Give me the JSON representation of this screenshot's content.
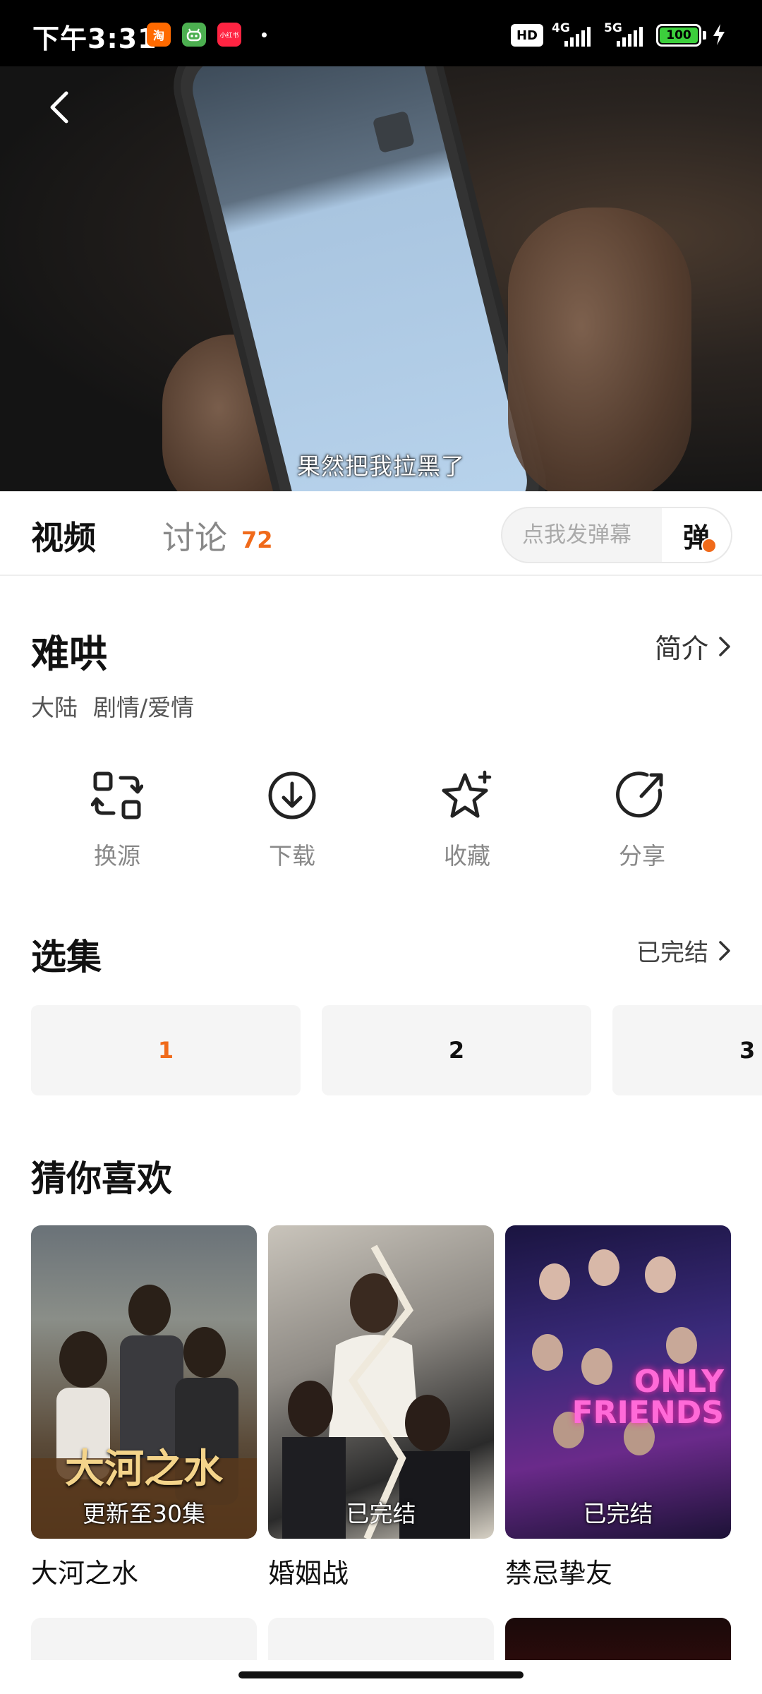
{
  "status_bar": {
    "time": "下午3:31",
    "apps": [
      {
        "name": "taobao-app-icon",
        "label": "淘",
        "color": "#ff6a00"
      },
      {
        "name": "android-app-icon",
        "label": "",
        "color": "#4caf50"
      },
      {
        "name": "xiaohongshu-app-icon",
        "label": "小红书",
        "color": "#ff2442"
      }
    ],
    "hd_label": "HD",
    "network_1": "4G",
    "network_2": "5G",
    "battery": "100"
  },
  "player": {
    "subtitle": "果然把我拉黑了"
  },
  "tabs": {
    "video": "视频",
    "discuss": "讨论",
    "discuss_count": "72",
    "danmaku_placeholder": "点我发弹幕",
    "danmaku_button": "弹"
  },
  "show": {
    "title": "难哄",
    "intro_label": "简介",
    "region": "大陆",
    "genre": "剧情/爱情"
  },
  "actions": [
    {
      "label": "换源",
      "icon": "switch-source-icon"
    },
    {
      "label": "下载",
      "icon": "download-icon"
    },
    {
      "label": "收藏",
      "icon": "favorite-star-icon"
    },
    {
      "label": "分享",
      "icon": "share-icon"
    }
  ],
  "episodes": {
    "section_title": "选集",
    "status": "已完结",
    "items": [
      "1",
      "2",
      "3"
    ],
    "active_index": 0
  },
  "recommendations": {
    "section_title": "猜你喜欢",
    "items": [
      {
        "name": "大河之水",
        "badge": "更新至30集",
        "poster_text": "大河之水"
      },
      {
        "name": "婚姻战",
        "badge": "已完结"
      },
      {
        "name": "禁忌挚友",
        "badge": "已完结",
        "poster_text": "ONLY FRIENDS"
      }
    ]
  },
  "colors": {
    "accent": "#f06a1a",
    "text_primary": "#111111",
    "text_secondary": "#888888"
  }
}
